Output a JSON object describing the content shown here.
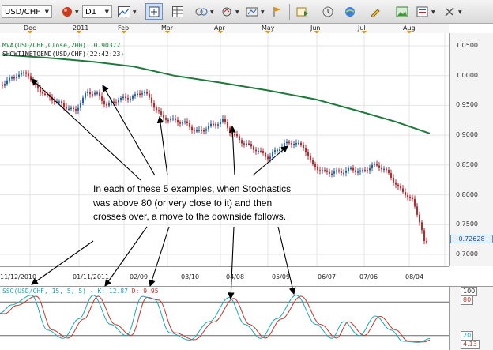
{
  "toolbar": {
    "symbol": "USD/CHF",
    "timeframe": "D1"
  },
  "months": [
    {
      "label": "Dec"
    },
    {
      "label": "2011"
    },
    {
      "label": "Feb"
    },
    {
      "label": "Mar"
    },
    {
      "label": "Apr"
    },
    {
      "label": "May"
    },
    {
      "label": "Jun"
    },
    {
      "label": "Jul"
    },
    {
      "label": "Aug"
    }
  ],
  "legend": {
    "mva": "MVA(USD/CHF,Close,200): 0.90372",
    "showtime": "SHOWTIMETOEND(USD/CHF)(22:42:23)"
  },
  "price_axis": {
    "ticks": [
      "1.0500",
      "1.0000",
      "0.9500",
      "0.9000",
      "0.8500",
      "0.8000",
      "0.7500",
      "0.7000"
    ],
    "current": "0.72628"
  },
  "dates": [
    "11/12/2010",
    "01/11/2011",
    "02/09",
    "03/10",
    "04/08",
    "05/09",
    "06/07",
    "07/06",
    "08/04"
  ],
  "stochastic": {
    "name": "SSO(USD/CHF, 15, 5, 5)",
    "k_label": "K: 12.87",
    "d_label": "D: 9.95",
    "levels": [
      "100",
      "80",
      "20",
      "4.13"
    ]
  },
  "annotation": {
    "lines": [
      "In each of these 5 examples, when Stochastics",
      "was above 80 (or very close to it) and then",
      "crosses over, a move to the downside follows."
    ]
  },
  "colors": {
    "mva_line": "#1e7a3c",
    "bull_candle": "#2a5fa8",
    "bear_candle": "#c0282e",
    "stoch_k": "#1aa6b7",
    "stoch_d": "#c0392b"
  }
}
